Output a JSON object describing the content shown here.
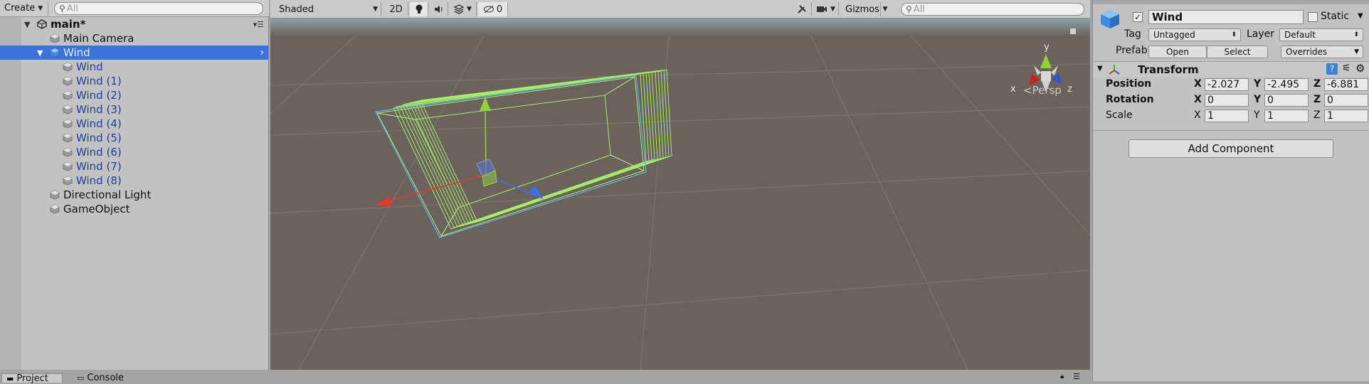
{
  "hierarchy": {
    "create_label": "Create",
    "search_placeholder": "All",
    "scene_name": "main*",
    "items": [
      {
        "label": "Main Camera",
        "style": "normal"
      },
      {
        "label": "Wind",
        "style": "selected"
      },
      {
        "label": "Wind",
        "style": "prefab"
      },
      {
        "label": "Wind (1)",
        "style": "prefab"
      },
      {
        "label": "Wind (2)",
        "style": "prefab"
      },
      {
        "label": "Wind (3)",
        "style": "prefab"
      },
      {
        "label": "Wind (4)",
        "style": "prefab"
      },
      {
        "label": "Wind (5)",
        "style": "prefab"
      },
      {
        "label": "Wind (6)",
        "style": "prefab"
      },
      {
        "label": "Wind (7)",
        "style": "prefab"
      },
      {
        "label": "Wind (8)",
        "style": "prefab"
      },
      {
        "label": "Directional Light",
        "style": "normal"
      },
      {
        "label": "GameObject",
        "style": "normal"
      }
    ]
  },
  "scene_view": {
    "shading_mode": "Shaded",
    "mode_2d": "2D",
    "hidden_count": "0",
    "gizmos_label": "Gizmos",
    "search_placeholder": "All",
    "persp_label": "Persp",
    "axis_x": "x",
    "axis_y": "y",
    "axis_z": "z",
    "colors": {
      "background": "#6b625d",
      "wireframe": "#9ee86a",
      "x_axis": "#e33a2c",
      "y_axis": "#8fd43a",
      "z_axis": "#3f6fe6"
    }
  },
  "inspector": {
    "object_name": "Wind",
    "static_label": "Static",
    "tag_label": "Tag",
    "tag_value": "Untagged",
    "layer_label": "Layer",
    "layer_value": "Default",
    "prefab_label": "Prefab",
    "open_label": "Open",
    "select_label": "Select",
    "overrides_label": "Overrides",
    "component_title": "Transform",
    "position_label": "Position",
    "rotation_label": "Rotation",
    "scale_label": "Scale",
    "x_label": "X",
    "y_label": "Y",
    "z_label": "Z",
    "position": {
      "x": "-2.027",
      "y": "-2.495",
      "z": "-6.881"
    },
    "rotation": {
      "x": "0",
      "y": "0",
      "z": "0"
    },
    "scale": {
      "x": "1",
      "y": "1",
      "z": "1"
    },
    "add_component_label": "Add Component"
  },
  "bottom_tabs": {
    "project_label": "Project",
    "console_label": "Console"
  }
}
